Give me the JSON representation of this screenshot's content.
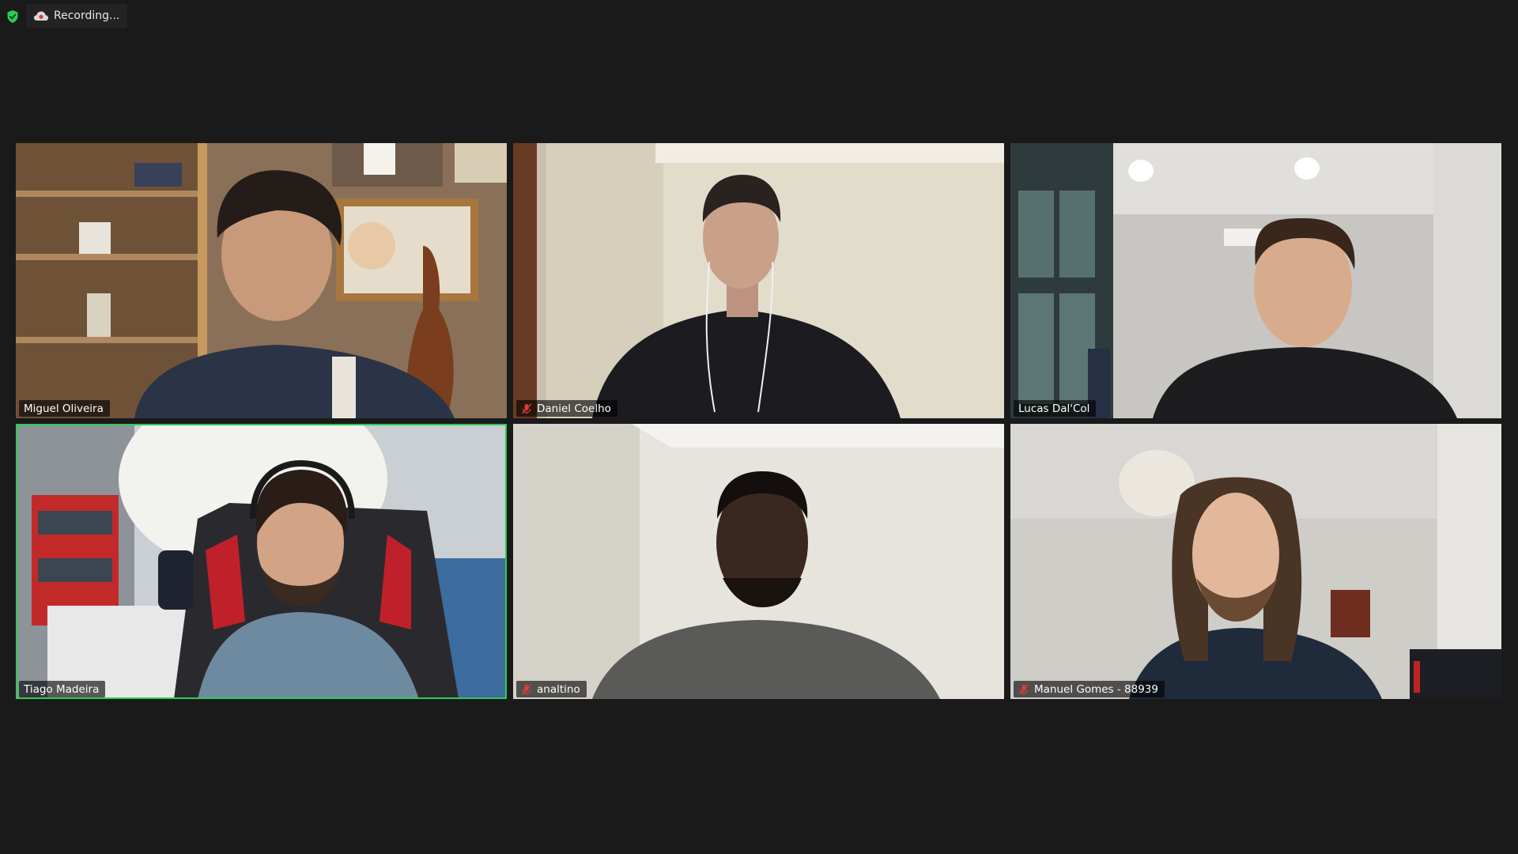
{
  "status": {
    "encryption_icon": "shield-check-icon",
    "recording_icon": "cloud-record-icon",
    "recording_label": "Recording..."
  },
  "participants": [
    {
      "name": "Miguel Oliveira",
      "muted": false,
      "speaking": false
    },
    {
      "name": "Daniel Coelho",
      "muted": true,
      "speaking": false
    },
    {
      "name": "Lucas Dal'Col",
      "muted": false,
      "speaking": false
    },
    {
      "name": "Tiago Madeira",
      "muted": false,
      "speaking": true
    },
    {
      "name": "analtino",
      "muted": true,
      "speaking": false
    },
    {
      "name": "Manuel Gomes - 88939",
      "muted": true,
      "speaking": false
    }
  ],
  "colors": {
    "background": "#1a1a1a",
    "speaking_border": "#2ecc55",
    "mute_icon": "#e03a3a",
    "shield": "#2ecc55"
  }
}
